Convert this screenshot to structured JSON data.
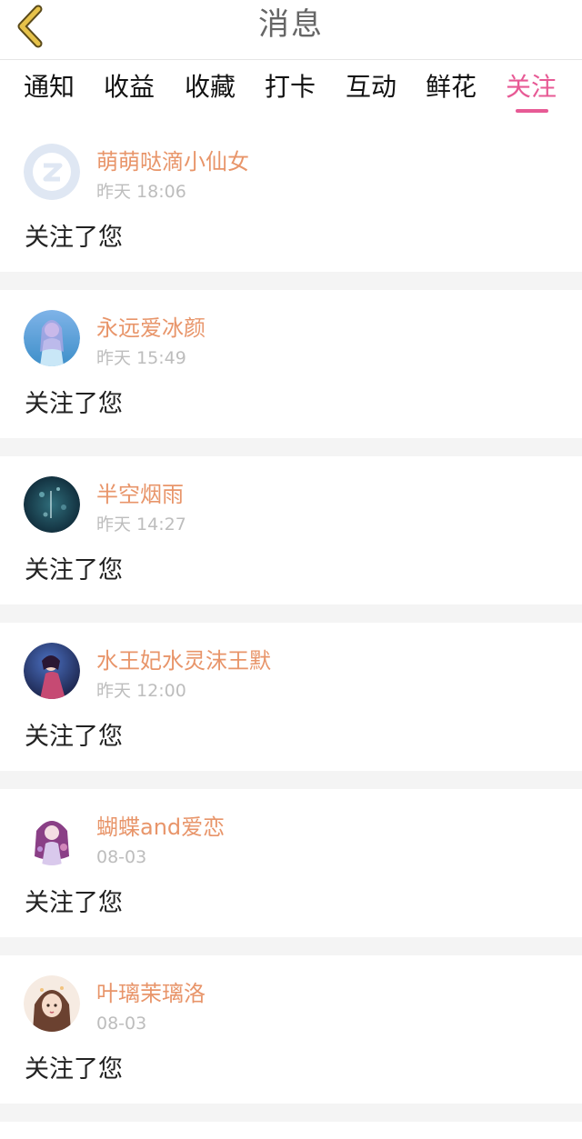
{
  "header": {
    "title": "消息",
    "back_icon": "chevron-left-icon",
    "back_icon_color": "#e6c24a"
  },
  "tabs": [
    {
      "label": "通知",
      "active": false
    },
    {
      "label": "收益",
      "active": false
    },
    {
      "label": "收藏",
      "active": false
    },
    {
      "label": "打卡",
      "active": false
    },
    {
      "label": "互动",
      "active": false
    },
    {
      "label": "鲜花",
      "active": false
    },
    {
      "label": "关注",
      "active": true
    }
  ],
  "colors": {
    "accent": "#e75a95",
    "nickname": "#e8956a",
    "time": "#bdbdbd",
    "separator": "#f4f4f4"
  },
  "notifications": [
    {
      "nickname": "萌萌哒滴小仙女",
      "time": "昨天 18:06",
      "message": "关注了您",
      "avatar": "default-avatar-icon"
    },
    {
      "nickname": "永远爱冰颜",
      "time": "昨天 15:49",
      "message": "关注了您",
      "avatar": "user-avatar"
    },
    {
      "nickname": "半空烟雨",
      "time": "昨天 14:27",
      "message": "关注了您",
      "avatar": "user-avatar"
    },
    {
      "nickname": "水王妃水灵沫王默",
      "time": "昨天 12:00",
      "message": "关注了您",
      "avatar": "user-avatar"
    },
    {
      "nickname": "蝴蝶and爱恋",
      "time": "08-03",
      "message": "关注了您",
      "avatar": "user-avatar"
    },
    {
      "nickname": "叶璃茉璃洛",
      "time": "08-03",
      "message": "关注了您",
      "avatar": "user-avatar"
    }
  ]
}
